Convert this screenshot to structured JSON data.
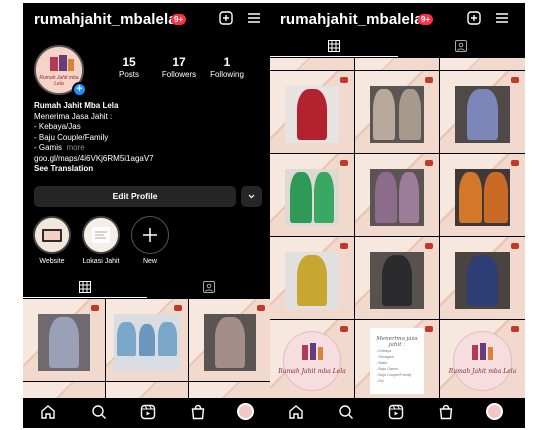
{
  "left": {
    "username": "rumahjahit_mbalela",
    "badge": "9+",
    "avatar_text": "Rumah Jahit mba Lela",
    "stats": [
      {
        "num": "15",
        "label": "Posts"
      },
      {
        "num": "17",
        "label": "Followers"
      },
      {
        "num": "1",
        "label": "Following"
      }
    ],
    "bio": {
      "name": "Rumah Jahit Mba Lela",
      "line1": "Menerima Jasa Jahit :",
      "line2": "- Kebaya/Jas",
      "line3": "- Baju Couple/Family",
      "line4": "- Gamis",
      "more": "more",
      "link": "goo.gl/maps/4i6VKj6RM5i1agaV7",
      "translate": "See Translation"
    },
    "edit_profile": "Edit Profile",
    "highlights": [
      {
        "label": "Website"
      },
      {
        "label": "Lokasi Jahit"
      },
      {
        "label": "New"
      }
    ],
    "grid_posts": [
      "dress-floral",
      "couple-family",
      "dress-grey",
      "dress-partial-1",
      "dress-partial-2",
      "dress-partial-3"
    ]
  },
  "right": {
    "username": "rumahjahit_mbalela",
    "badge": "9+",
    "grid_posts": [
      "dress-red",
      "dress-batik",
      "dress-blue-batik",
      "dress-green",
      "dress-purple",
      "dress-orange",
      "dress-yellow",
      "dress-black",
      "dress-navy",
      "logo",
      "menu-paper",
      "logo"
    ],
    "logo_text": "Rumah Jahit mba Lela",
    "paper": {
      "title": "Menerima jasa jahit :",
      "items": [
        "- Kebaya",
        "- Seragam",
        "- Batik",
        "- Baju Gamis",
        "- Baju Couple/Family",
        "- Etc"
      ]
    }
  },
  "colors": {
    "background": "#000000",
    "badge": "#ff3040",
    "accent": "#1d8fff",
    "tile": "#f2d9cd"
  },
  "icons": [
    "plus-square-icon",
    "menu-icon",
    "grid-icon",
    "tagged-icon",
    "home-icon",
    "search-icon",
    "reels-icon",
    "shop-icon",
    "profile-avatar-icon",
    "chevron-down-icon",
    "plus-icon"
  ]
}
